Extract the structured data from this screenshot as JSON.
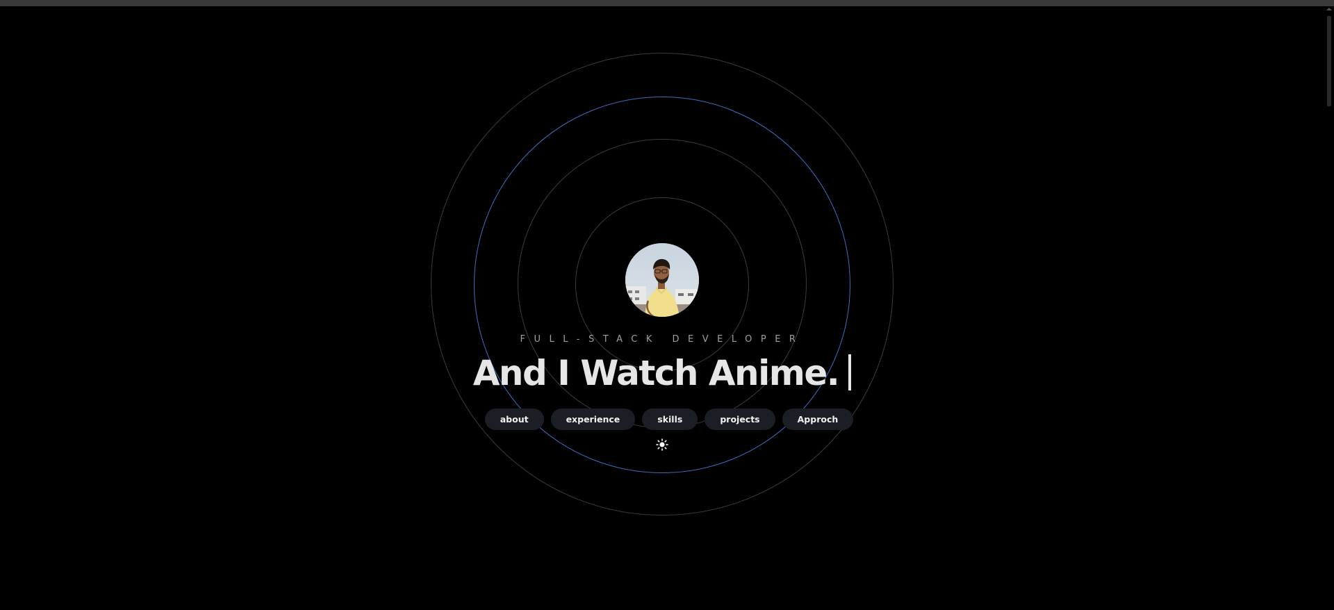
{
  "hero": {
    "subtitle": "FULL-STACK DEVELOPER",
    "headline": "And I Watch Anime."
  },
  "nav": {
    "items": [
      {
        "label": "about"
      },
      {
        "label": "experience"
      },
      {
        "label": "skills"
      },
      {
        "label": "projects"
      },
      {
        "label": "Approch"
      }
    ]
  },
  "theme_toggle": {
    "icon": "sun-icon"
  },
  "colors": {
    "background": "#000000",
    "accent_ring": "#3d6fc2",
    "ring": "#3c3c3c",
    "pill_bg": "#1b1e24",
    "headline": "#e6e6e6"
  }
}
